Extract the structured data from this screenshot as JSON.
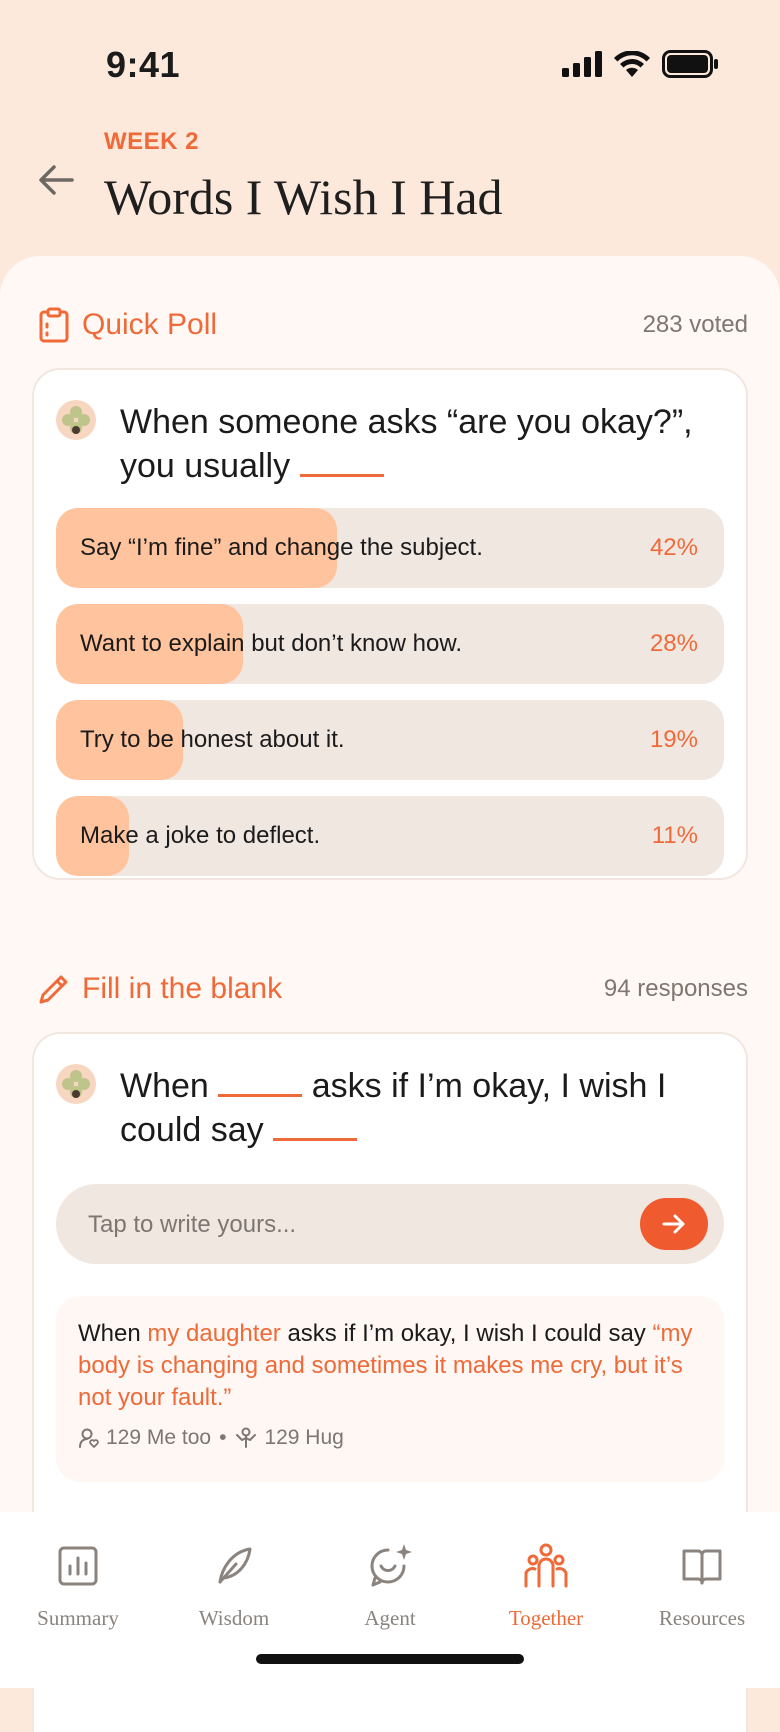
{
  "status": {
    "time": "9:41"
  },
  "header": {
    "week": "WEEK 2",
    "title": "Words I Wish I Had"
  },
  "poll": {
    "section_title": "Quick Poll",
    "voted": "283 voted",
    "question_text": "When someone asks “are you okay?”, you usually",
    "options": [
      {
        "label": "Say “I’m fine” and change the subject.",
        "percent": "42%",
        "value": 42
      },
      {
        "label": "Want to explain but don’t know how.",
        "percent": "28%",
        "value": 28
      },
      {
        "label": "Try to be honest about it.",
        "percent": "19%",
        "value": 19
      },
      {
        "label": "Make a joke to deflect.",
        "percent": "11%",
        "value": 11
      }
    ]
  },
  "fill": {
    "section_title": "Fill in the blank",
    "responses": "94 responses",
    "question_a": "When",
    "question_b": "asks if I’m okay, I wish I could say",
    "input_placeholder": "Tap to write yours...",
    "response": {
      "t1": "When ",
      "t2": "my daughter",
      "t3": " asks if I’m okay, I wish I could say ",
      "t4": "“my body is changing and sometimes it makes me cry, but it’s not your fault.”",
      "metoo": "129 Me too",
      "separator": "•",
      "hug": "129 Hug"
    }
  },
  "tabs": [
    {
      "label": "Summary",
      "icon": "chart-icon"
    },
    {
      "label": "Wisdom",
      "icon": "feather-icon"
    },
    {
      "label": "Agent",
      "icon": "agent-icon"
    },
    {
      "label": "Together",
      "icon": "people-icon",
      "active": true
    },
    {
      "label": "Resources",
      "icon": "book-icon"
    }
  ],
  "colors": {
    "accent": "#EF6A38",
    "fill": "#FFC39E",
    "track": "#F1E7E1",
    "header_bg": "#FDE9DC"
  }
}
